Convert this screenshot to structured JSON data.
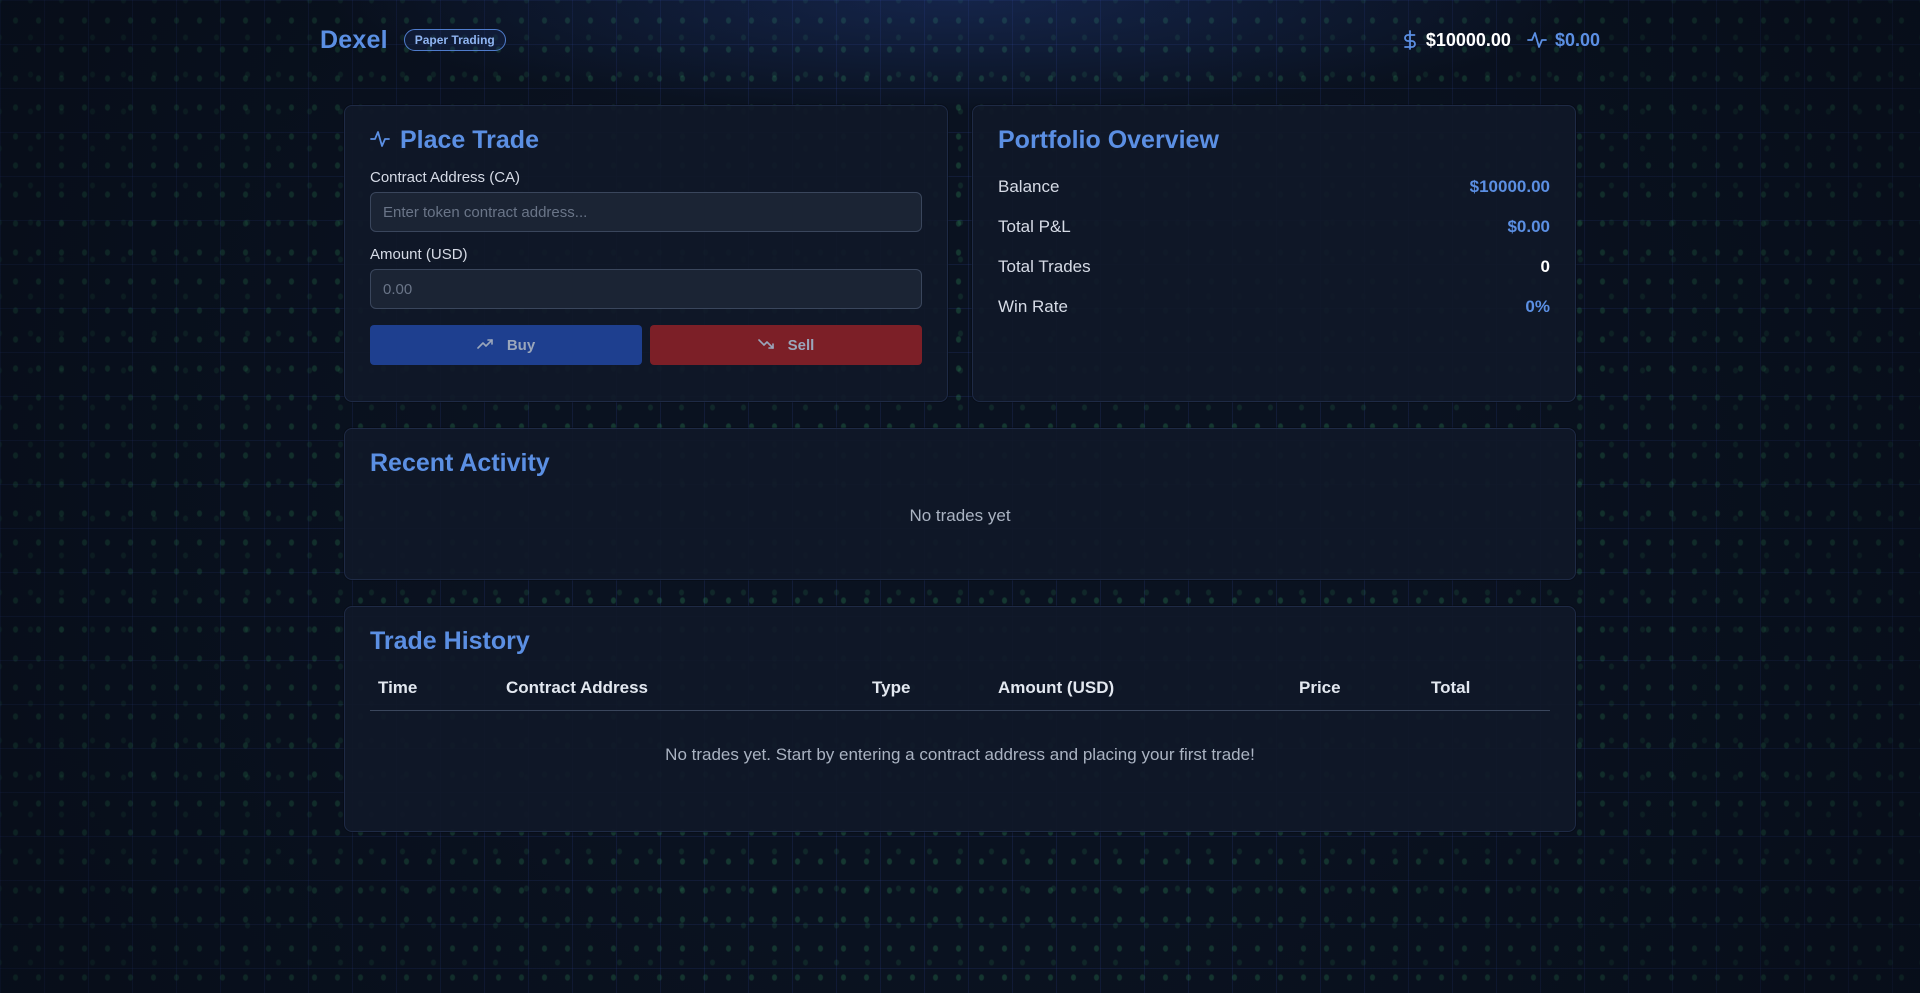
{
  "header": {
    "logo": "Dexel",
    "badge": "Paper Trading",
    "balance": "$10000.00",
    "pnl": "$0.00"
  },
  "place_trade": {
    "title": "Place Trade",
    "ca_label": "Contract Address (CA)",
    "ca_placeholder": "Enter token contract address...",
    "ca_value": "",
    "amount_label": "Amount (USD)",
    "amount_placeholder": "0.00",
    "amount_value": "",
    "buy_label": "Buy",
    "sell_label": "Sell"
  },
  "portfolio": {
    "title": "Portfolio Overview",
    "rows": [
      {
        "label": "Balance",
        "value": "$10000.00"
      },
      {
        "label": "Total P&L",
        "value": "$0.00"
      },
      {
        "label": "Total Trades",
        "value": "0"
      },
      {
        "label": "Win Rate",
        "value": "0%"
      }
    ]
  },
  "recent_activity": {
    "title": "Recent Activity",
    "empty": "No trades yet"
  },
  "trade_history": {
    "title": "Trade History",
    "columns": [
      "Time",
      "Contract Address",
      "Type",
      "Amount (USD)",
      "Price",
      "Total"
    ],
    "empty": "No trades yet. Start by entering a contract address and placing your first trade!"
  },
  "colors": {
    "accent": "#5b8fe3",
    "buy": "#1e3f8f",
    "sell": "#7c1f27",
    "card": "#101828"
  },
  "icons": {
    "balance": "dollar-icon",
    "pnl": "activity-icon",
    "place_trade": "activity-icon",
    "buy": "trending-up-icon",
    "sell": "trending-down-icon"
  }
}
